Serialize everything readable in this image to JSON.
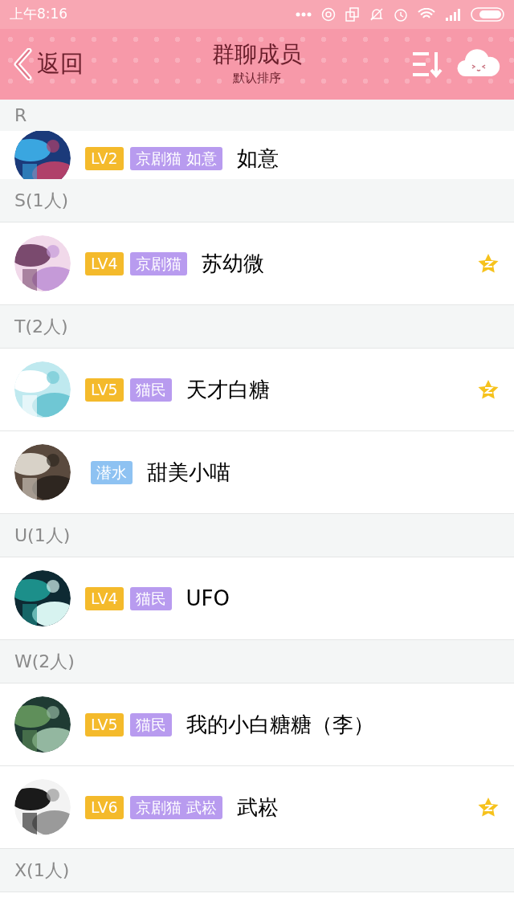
{
  "status_bar": {
    "time": "上午8:16"
  },
  "header": {
    "back": "返回",
    "title": "群聊成员",
    "subtitle": "默认排序"
  },
  "sections": [
    {
      "header": "R",
      "clipped": true,
      "members": [
        {
          "badges": [
            {
              "kind": "level",
              "text": "LV2"
            },
            {
              "kind": "title",
              "text": "京剧猫 如意"
            }
          ],
          "name": "如意",
          "starred": false
        }
      ]
    },
    {
      "header": "S(1人)",
      "members": [
        {
          "badges": [
            {
              "kind": "level",
              "text": "LV4"
            },
            {
              "kind": "title",
              "text": "京剧猫"
            }
          ],
          "name": "苏幼微",
          "starred": true
        }
      ]
    },
    {
      "header": "T(2人)",
      "members": [
        {
          "badges": [
            {
              "kind": "level",
              "text": "LV5"
            },
            {
              "kind": "title",
              "text": "猫民"
            }
          ],
          "name": "天才白糖",
          "starred": true
        },
        {
          "badges": [
            {
              "kind": "lurker",
              "text": "潜水"
            }
          ],
          "name": "甜美小喵",
          "starred": false
        }
      ]
    },
    {
      "header": "U(1人)",
      "members": [
        {
          "badges": [
            {
              "kind": "level",
              "text": "LV4"
            },
            {
              "kind": "title",
              "text": "猫民"
            }
          ],
          "name": "UFO",
          "starred": false
        }
      ]
    },
    {
      "header": "W(2人)",
      "members": [
        {
          "badges": [
            {
              "kind": "level",
              "text": "LV5"
            },
            {
              "kind": "title",
              "text": "猫民"
            }
          ],
          "name": "我的小白糖糖（李）",
          "starred": false
        },
        {
          "badges": [
            {
              "kind": "level",
              "text": "LV6"
            },
            {
              "kind": "title",
              "text": "京剧猫 武崧"
            }
          ],
          "name": "武崧",
          "starred": true
        }
      ]
    },
    {
      "header": "X(1人)"
    }
  ]
}
